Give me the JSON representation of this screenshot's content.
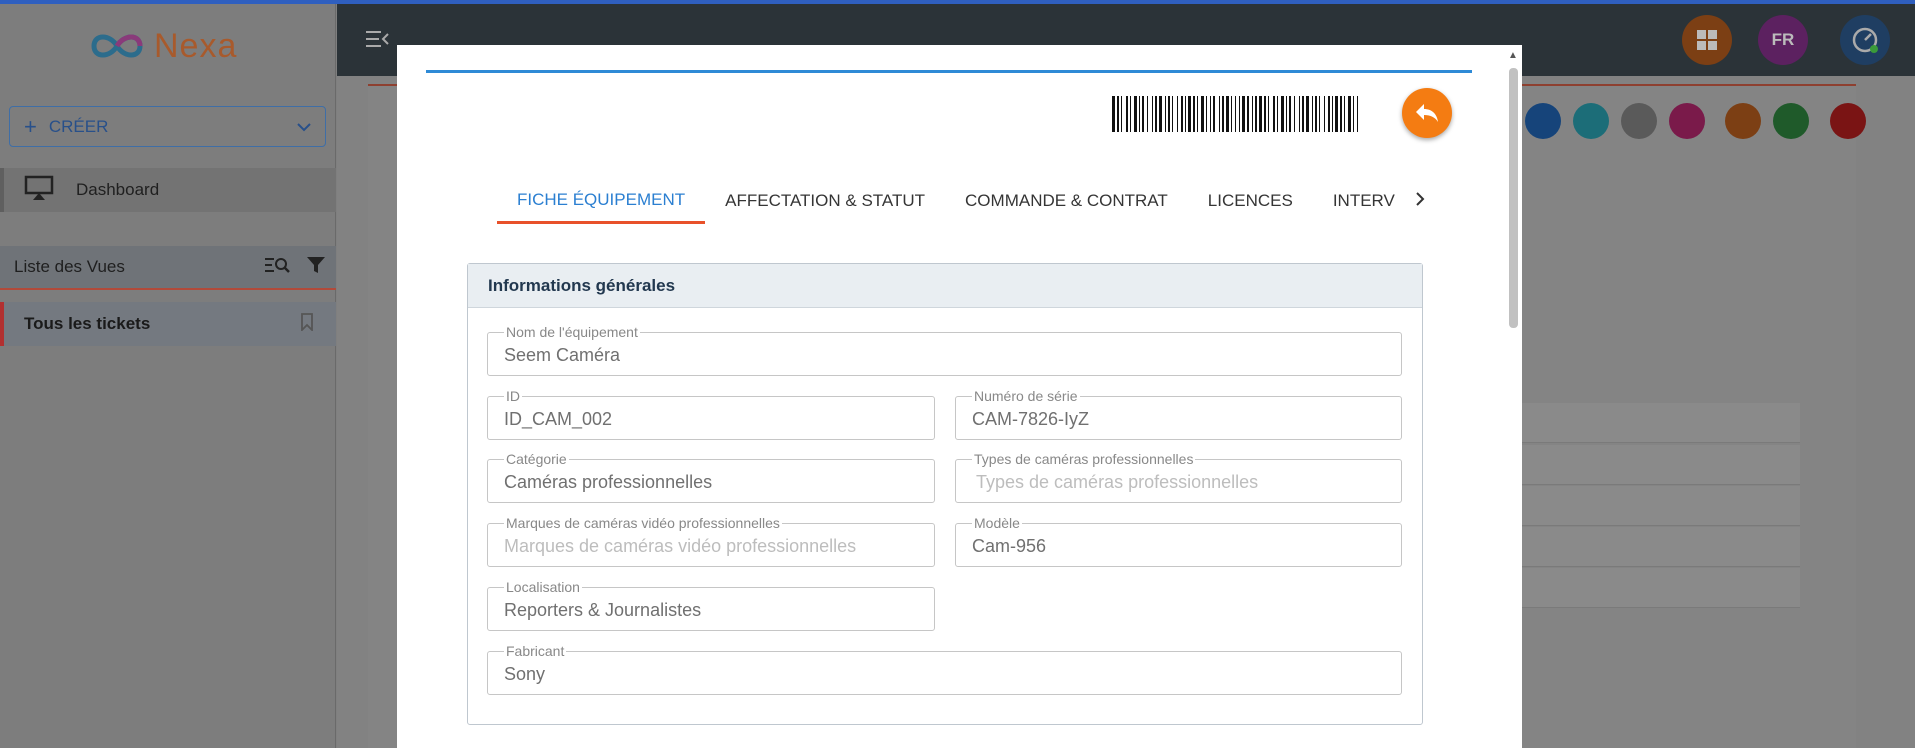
{
  "brand": {
    "name": "Nexa"
  },
  "sidebar": {
    "create_label": "CRÉER",
    "dashboard_label": "Dashboard",
    "views_title": "Liste des Vues",
    "view_item": "Tous les tickets"
  },
  "header": {
    "lang": "FR"
  },
  "modal": {
    "tabs": [
      {
        "label": "FICHE ÉQUIPEMENT",
        "active": true
      },
      {
        "label": "AFFECTATION & STATUT"
      },
      {
        "label": "COMMANDE & CONTRAT"
      },
      {
        "label": "LICENCES"
      },
      {
        "label": "INTERV"
      }
    ],
    "section_title": "Informations générales",
    "fields": {
      "nom": {
        "label": "Nom de l'équipement",
        "value": "Seem Caméra"
      },
      "id": {
        "label": "ID",
        "value": "ID_CAM_002"
      },
      "serie": {
        "label": "Numéro de série",
        "value": "CAM-7826-IyZ"
      },
      "categorie": {
        "label": "Catégorie",
        "value": "Caméras professionnelles"
      },
      "types": {
        "label": "Types de caméras professionnelles",
        "placeholder": "Types de caméras professionnelles"
      },
      "marques": {
        "label": "Marques de caméras vidéo professionnelles",
        "placeholder": "Marques de caméras vidéo professionnelles"
      },
      "modele": {
        "label": "Modèle",
        "value": "Cam-956"
      },
      "localisation": {
        "label": "Localisation",
        "value": "Reporters & Journalistes"
      },
      "fabricant": {
        "label": "Fabricant",
        "value": "Sony"
      }
    }
  },
  "colors": {
    "accent_blue": "#2b7fd1",
    "accent_orange": "#f47c12",
    "tab_underline": "#e8512a"
  }
}
